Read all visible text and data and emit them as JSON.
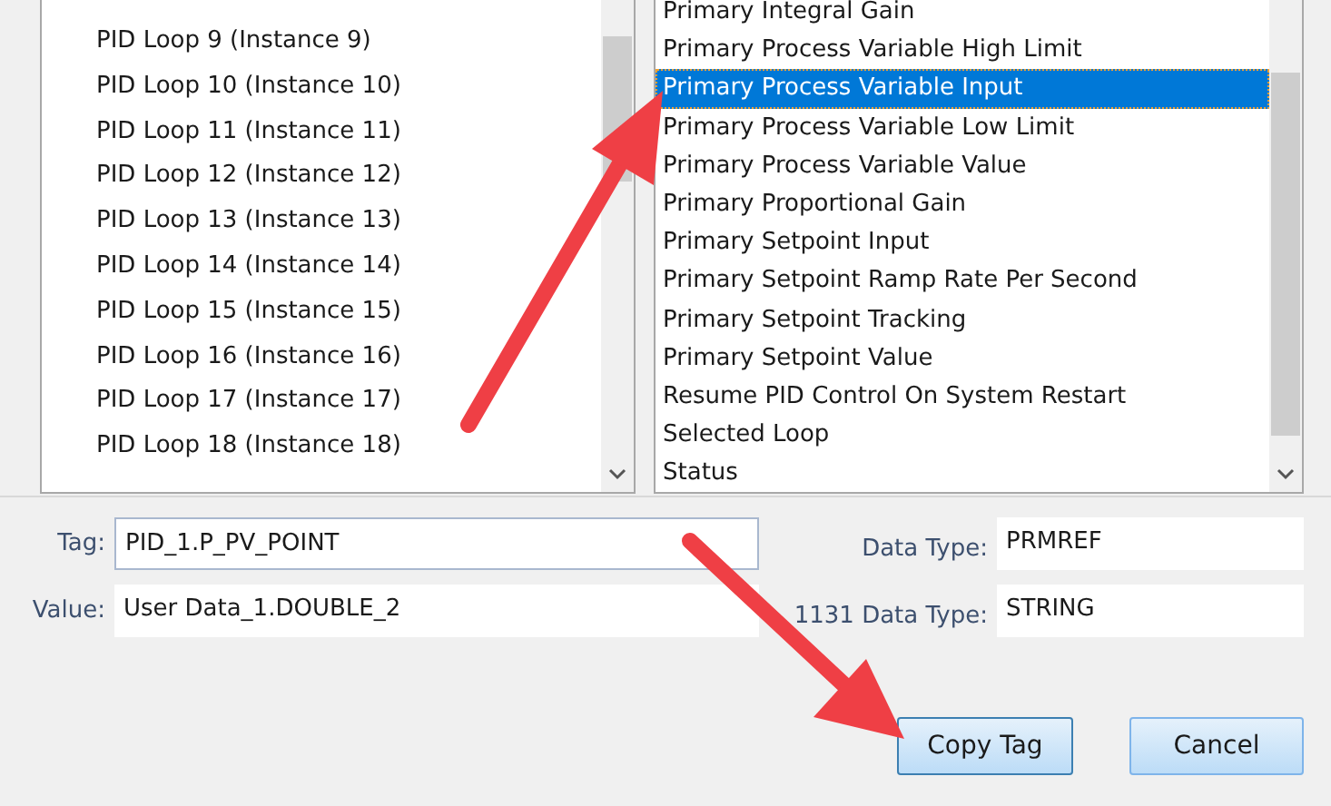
{
  "loops_list": {
    "items": [
      {
        "label": "PID Loop 9 (Instance 9)",
        "selected": false
      },
      {
        "label": "PID Loop 10 (Instance 10)",
        "selected": false
      },
      {
        "label": "PID Loop 11 (Instance 11)",
        "selected": false
      },
      {
        "label": "PID Loop 12 (Instance 12)",
        "selected": false
      },
      {
        "label": "PID Loop 13 (Instance 13)",
        "selected": false
      },
      {
        "label": "PID Loop 14 (Instance 14)",
        "selected": false
      },
      {
        "label": "PID Loop 15 (Instance 15)",
        "selected": false
      },
      {
        "label": "PID Loop 16 (Instance 16)",
        "selected": false
      },
      {
        "label": "PID Loop 17 (Instance 17)",
        "selected": false
      },
      {
        "label": "PID Loop 18 (Instance 18)",
        "selected": false
      }
    ]
  },
  "tags_list": {
    "items": [
      {
        "label": "Primary Integral Gain",
        "selected": false
      },
      {
        "label": "Primary Process Variable High Limit",
        "selected": false
      },
      {
        "label": "Primary Process Variable Input",
        "selected": true
      },
      {
        "label": "Primary Process Variable Low Limit",
        "selected": false
      },
      {
        "label": "Primary Process Variable Value",
        "selected": false
      },
      {
        "label": "Primary Proportional Gain",
        "selected": false
      },
      {
        "label": "Primary Setpoint Input",
        "selected": false
      },
      {
        "label": "Primary Setpoint Ramp Rate Per Second",
        "selected": false
      },
      {
        "label": "Primary Setpoint Tracking",
        "selected": false
      },
      {
        "label": "Primary Setpoint Value",
        "selected": false
      },
      {
        "label": "Resume PID Control On System Restart",
        "selected": false
      },
      {
        "label": "Selected Loop",
        "selected": false
      },
      {
        "label": "Status",
        "selected": false
      }
    ]
  },
  "fields": {
    "tag": {
      "label": "Tag:",
      "value": "PID_1.P_PV_POINT"
    },
    "value": {
      "label": "Value:",
      "value": "User Data_1.DOUBLE_2"
    },
    "data_type": {
      "label": "Data Type:",
      "value": "PRMREF"
    },
    "iec_data_type": {
      "label": "1131 Data Type:",
      "value": "STRING"
    }
  },
  "buttons": [
    {
      "label": "Copy Tag",
      "focused": true
    },
    {
      "label": "Cancel",
      "focused": false
    }
  ]
}
